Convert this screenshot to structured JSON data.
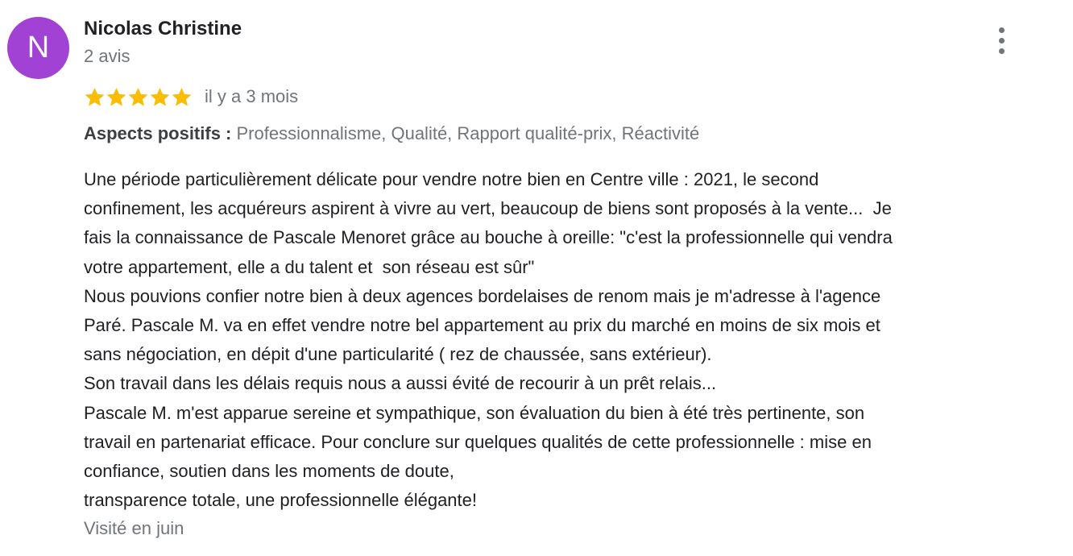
{
  "review": {
    "author": {
      "initial": "N",
      "name": "Nicolas Christine",
      "review_count": "2 avis",
      "avatar_color": "#a142d4"
    },
    "menu_icon": "more-vert-icon",
    "rating": {
      "stars": 5,
      "max": 5,
      "star_color": "#fbbc04",
      "icon": "star-icon"
    },
    "date": "il y a 3 mois",
    "aspects": {
      "label": "Aspects positifs :",
      "values": "Professionnalisme, Qualité, Rapport qualité-prix, Réactivité"
    },
    "body_lines": [
      "Une période particulièrement délicate pour vendre notre bien en Centre ville : 2021, le second",
      "confinement, les acquéreurs aspirent à vivre au vert, beaucoup de biens sont proposés à la vente...  Je",
      "fais la connaissance de Pascale Menoret grâce au bouche à oreille: \"c'est la professionnelle qui vendra",
      "votre appartement, elle a du talent et  son réseau est sûr\"",
      "Nous pouvions confier notre bien à deux agences bordelaises de renom mais je m'adresse à l'agence",
      "Paré. Pascale M. va en effet vendre notre bel appartement au prix du marché en moins de six mois et",
      "sans négociation, en dépit d'une particularité ( rez de chaussée, sans extérieur).",
      "Son travail dans les délais requis nous a aussi évité de recourir à un prêt relais...",
      "Pascale M. m'est apparue sereine et sympathique, son évaluation du bien à été très pertinente, son",
      "travail en partenariat efficace. Pour conclure sur quelques qualités de cette professionnelle : mise en",
      "confiance, soutien dans les moments de doute,",
      "transparence totale, une professionnelle élégante!"
    ],
    "visited": "Visité en juin"
  }
}
